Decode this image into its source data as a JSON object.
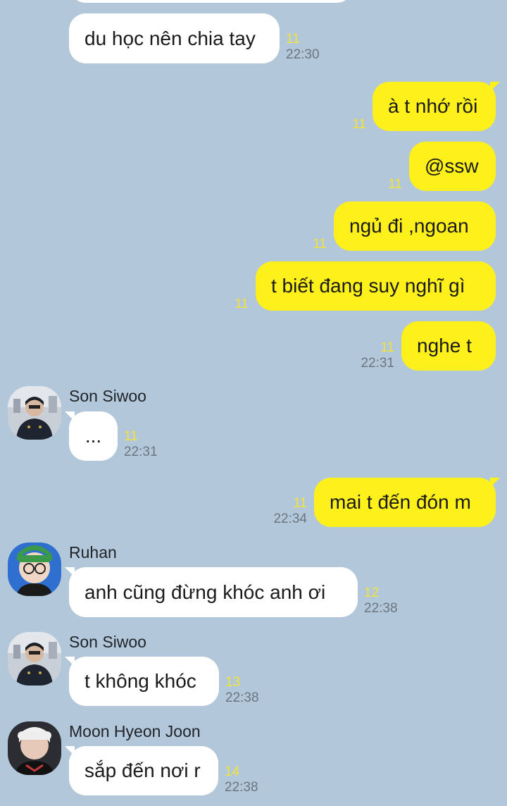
{
  "chat": {
    "messages": [
      {
        "id": "m0",
        "side": "in",
        "text": "du học nên chia tay",
        "count": "11",
        "time": "22:30"
      },
      {
        "id": "m1",
        "side": "out",
        "text": "à t nhớ rồi",
        "count": "11"
      },
      {
        "id": "m2",
        "side": "out",
        "text": "@ssw",
        "count": "11"
      },
      {
        "id": "m3",
        "side": "out",
        "text": "ngủ đi ,ngoan",
        "count": "11"
      },
      {
        "id": "m4",
        "side": "out",
        "text": "t biết đang suy nghĩ gì",
        "count": "11"
      },
      {
        "id": "m5",
        "side": "out",
        "text": "nghe t",
        "count": "11",
        "time": "22:31"
      },
      {
        "id": "m6",
        "side": "in",
        "sender": "Son Siwoo",
        "avatar": "avatar-son-siwoo",
        "text": "...",
        "count": "11",
        "time": "22:31"
      },
      {
        "id": "m7",
        "side": "out",
        "text": "mai t đến đón m",
        "count": "11",
        "time": "22:34"
      },
      {
        "id": "m8",
        "side": "in",
        "sender": "Ruhan",
        "avatar": "avatar-ruhan",
        "text": "anh cũng đừng khóc anh ơi",
        "count": "12",
        "time": "22:38"
      },
      {
        "id": "m9",
        "side": "in",
        "sender": "Son Siwoo",
        "avatar": "avatar-son-siwoo",
        "text": "t không khóc",
        "count": "13",
        "time": "22:38"
      },
      {
        "id": "m10",
        "side": "in",
        "sender": "Moon Hyeon Joon",
        "avatar": "avatar-moon-hyeon-joon",
        "text": "sắp đến nơi r",
        "count": "14",
        "time": "22:38"
      }
    ]
  },
  "colors": {
    "background": "#b2c7d9",
    "incoming_bubble": "#ffffff",
    "outgoing_bubble": "#fef01b",
    "unread_count": "#f2e33a",
    "timestamp": "#6b7680"
  }
}
